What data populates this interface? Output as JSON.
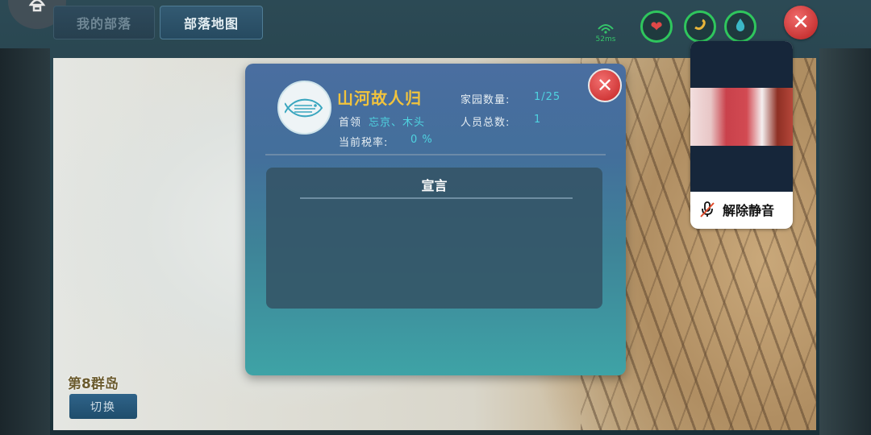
{
  "top_bar": {
    "corner_icon": "lamp-icon",
    "tabs": [
      {
        "label": "我的部落",
        "active": false
      },
      {
        "label": "部落地图",
        "active": true
      }
    ],
    "ping": "52ms",
    "status_icons": [
      "heart-icon",
      "swap-icon",
      "water-drop-icon"
    ],
    "close_icon": "close-icon"
  },
  "tribe": {
    "name": "山河故人归",
    "leader_label": "首领",
    "leaders": "忘京、木头",
    "tax_label": "当前税率:",
    "tax_value": "0 %",
    "homes_label": "家园数量:",
    "homes_value": "1/25",
    "members_label": "人员总数:",
    "members_value": "1",
    "emblem_icon": "fish-emblem-icon",
    "declaration_title": "宣言",
    "declaration_text": ""
  },
  "map": {
    "island_label": "第8群岛",
    "switch_label": "切换"
  },
  "video_call": {
    "unmute_label": "解除静音",
    "mic_icon": "mic-muted-icon"
  },
  "colors": {
    "accent_gold": "#f1c33d",
    "value_cyan": "#4fd3e0",
    "close_red": "#c42424",
    "status_green": "#2fc65d"
  }
}
